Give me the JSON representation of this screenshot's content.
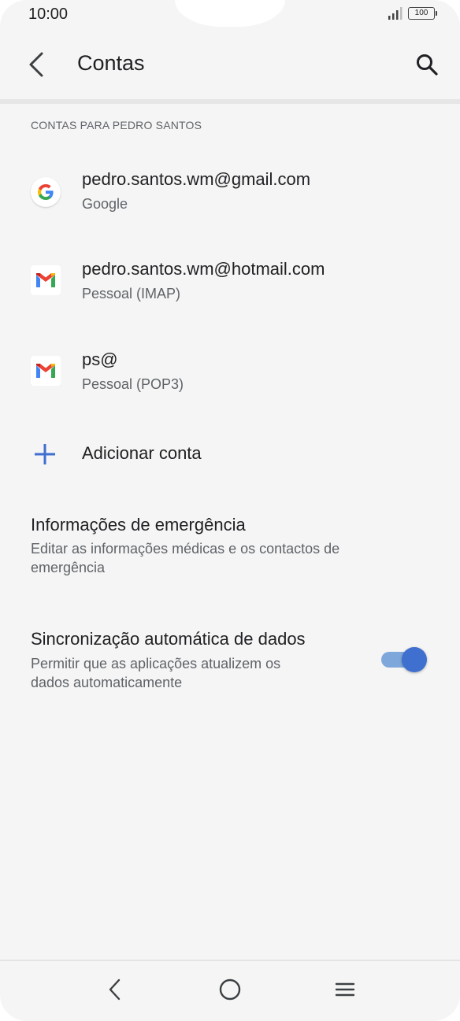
{
  "status_bar": {
    "time": "10:00",
    "battery": "100",
    "icons": [
      "signal-icon",
      "battery-icon"
    ]
  },
  "app_bar": {
    "title": "Contas",
    "icons": [
      "back-arrow-icon",
      "search-icon"
    ]
  },
  "accounts_section": {
    "header": "CONTAS PARA PEDRO SANTOS",
    "items": [
      {
        "title": "pedro.santos.wm@gmail.com",
        "subtitle": "Google",
        "icon": "google-icon"
      },
      {
        "title": "pedro.santos.wm@hotmail.com",
        "subtitle": "Pessoal (IMAP)",
        "icon": "gmail-icon"
      },
      {
        "title": "ps@",
        "subtitle": "Pessoal (POP3)",
        "icon": "gmail-icon"
      }
    ],
    "add_account": {
      "label": "Adicionar conta",
      "icon": "plus-icon"
    }
  },
  "preferences": {
    "emergency": {
      "title": "Informações de emergência",
      "description_line1": "Editar as informações médicas e os contactos de",
      "description_line2": "emergência"
    },
    "auto_sync": {
      "title": "Sincronização automática de dados",
      "description_line1": "Permitir que as aplicações atualizem os",
      "description_line2": "dados automaticamente",
      "enabled": true
    }
  },
  "nav_bar": {
    "icons": [
      "nav-back-icon",
      "nav-home-icon",
      "nav-menu-icon"
    ]
  },
  "colors": {
    "accent": "#3f6fcf",
    "toggle_track": "#7ea7db",
    "background": "#f5f5f5",
    "plus_icon": "#3f6fcf"
  }
}
